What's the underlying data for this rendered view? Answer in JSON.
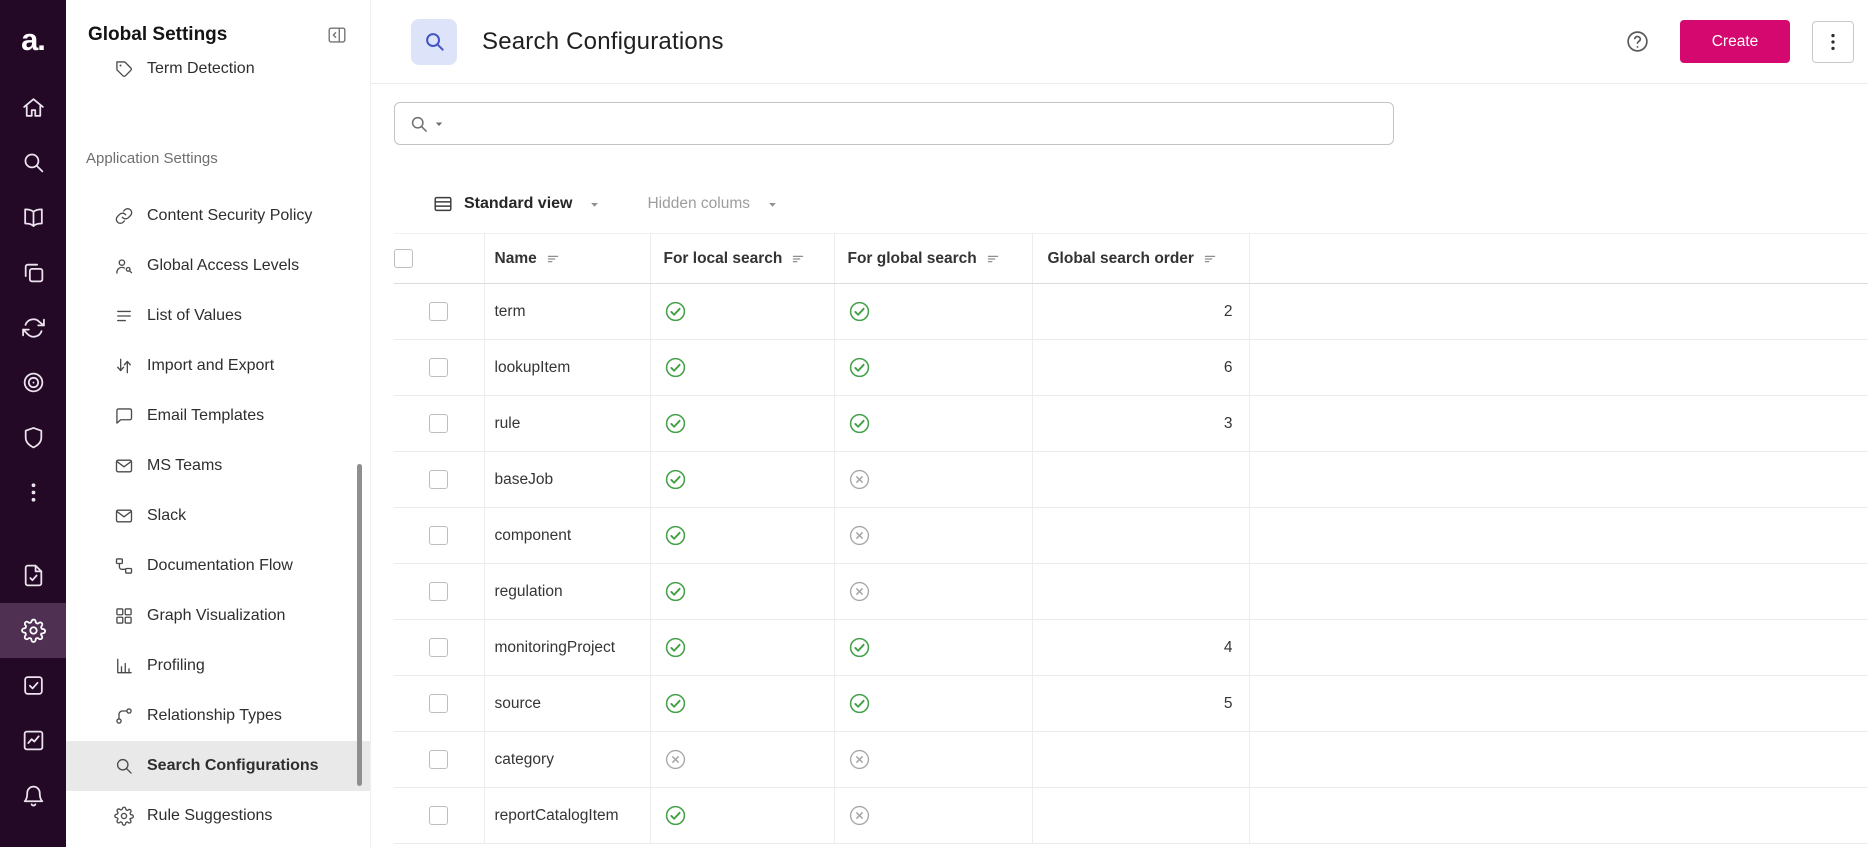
{
  "colors": {
    "rail_bg": "#230926",
    "rail_selected_bg": "#4f3053",
    "accent_pink": "#d4086e",
    "title_icon_bg": "#dde4f9",
    "title_icon_fg": "#4356c6",
    "check_green": "#43a047",
    "cross_grey": "#a6a6a6",
    "selected_item_bg": "#e9e9e9"
  },
  "rail": {
    "logo_text": "a.",
    "items": [
      {
        "icon": "home"
      },
      {
        "icon": "search"
      },
      {
        "icon": "book"
      },
      {
        "icon": "stack"
      },
      {
        "icon": "sync"
      },
      {
        "icon": "target"
      },
      {
        "icon": "shield"
      },
      {
        "icon": "kebab"
      },
      {
        "icon": "file-check",
        "gap_before": true
      },
      {
        "icon": "gear",
        "selected": true
      },
      {
        "icon": "task-check"
      },
      {
        "icon": "chart"
      },
      {
        "icon": "bell"
      }
    ]
  },
  "sidebar": {
    "title": "Global Settings",
    "top_items": [
      {
        "icon": "tag",
        "label": "Term Detection",
        "clipped": true
      }
    ],
    "section_label": "Application Settings",
    "items": [
      {
        "icon": "link",
        "label": "Content Security Policy"
      },
      {
        "icon": "access",
        "label": "Global Access Levels"
      },
      {
        "icon": "list",
        "label": "List of Values"
      },
      {
        "icon": "import-export",
        "label": "Import and Export"
      },
      {
        "icon": "message",
        "label": "Email Templates"
      },
      {
        "icon": "envelope",
        "label": "MS Teams"
      },
      {
        "icon": "envelope",
        "label": "Slack"
      },
      {
        "icon": "flow",
        "label": "Documentation Flow"
      },
      {
        "icon": "grid",
        "label": "Graph Visualization"
      },
      {
        "icon": "barchart",
        "label": "Profiling"
      },
      {
        "icon": "relationship",
        "label": "Relationship Types"
      },
      {
        "icon": "search",
        "label": "Search Configurations",
        "selected": true
      },
      {
        "icon": "gear",
        "label": "Rule Suggestions"
      }
    ]
  },
  "header": {
    "title": "Search Configurations",
    "create_label": "Create"
  },
  "search": {
    "value": "",
    "placeholder": ""
  },
  "toolbar": {
    "view_label": "Standard view",
    "hidden_columns_label": "Hidden colums"
  },
  "table": {
    "columns": [
      {
        "label": "Name"
      },
      {
        "label": "For local search"
      },
      {
        "label": "For global search"
      },
      {
        "label": "Global search order"
      }
    ],
    "rows": [
      {
        "name": "term",
        "local": "check",
        "global": "check",
        "order": "2"
      },
      {
        "name": "lookupItem",
        "local": "check",
        "global": "check",
        "order": "6"
      },
      {
        "name": "rule",
        "local": "check",
        "global": "check",
        "order": "3"
      },
      {
        "name": "baseJob",
        "local": "check",
        "global": "cross",
        "order": ""
      },
      {
        "name": "component",
        "local": "check",
        "global": "cross",
        "order": ""
      },
      {
        "name": "regulation",
        "local": "check",
        "global": "cross",
        "order": ""
      },
      {
        "name": "monitoringProject",
        "local": "check",
        "global": "check",
        "order": "4"
      },
      {
        "name": "source",
        "local": "check",
        "global": "check",
        "order": "5"
      },
      {
        "name": "category",
        "local": "cross",
        "global": "cross",
        "order": ""
      },
      {
        "name": "reportCatalogItem",
        "local": "check",
        "global": "cross",
        "order": ""
      }
    ]
  }
}
